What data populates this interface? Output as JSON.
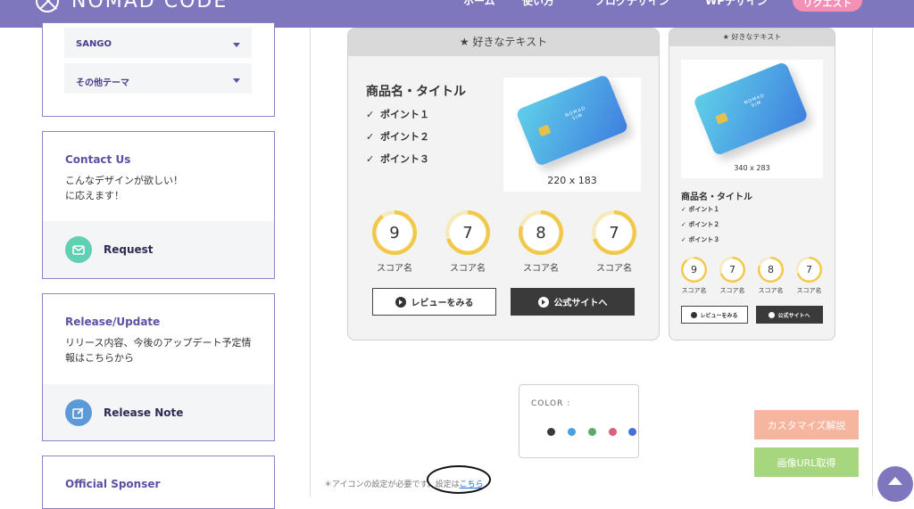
{
  "header": {
    "logo_text": "NOMAD CODE",
    "nav": [
      "ホーム",
      "使い方",
      "ブログデザイン",
      "WPデザイン"
    ],
    "request_button": "リクエスト"
  },
  "sidebar": {
    "themes": [
      {
        "label": "SANGO"
      },
      {
        "label": "その他テーマ"
      }
    ],
    "contact": {
      "title": "Contact Us",
      "text_line1": "こんなデザインが欲しい！",
      "text_line2": "に応えます！",
      "button": "Request"
    },
    "release": {
      "title": "Release/Update",
      "text_line1": "リリース内容、今後のアップデート予定情",
      "text_line2": "報はこちらから",
      "button": "Release Note"
    },
    "sponsor": {
      "title": "Official Sponser"
    }
  },
  "big_card": {
    "header": "好きなテキスト",
    "product_title": "商品名・タイトル",
    "points": [
      "ポイント１",
      "ポイント２",
      "ポイント３"
    ],
    "image_caption": "220 x 183",
    "sim_text_1": "NOMAD",
    "sim_text_2": "SIM",
    "scores": [
      {
        "value": "9",
        "label": "スコア名",
        "fraction": 0.9
      },
      {
        "value": "7",
        "label": "スコア名",
        "fraction": 0.7
      },
      {
        "value": "8",
        "label": "スコア名",
        "fraction": 0.8
      },
      {
        "value": "7",
        "label": "スコア名",
        "fraction": 0.7
      }
    ],
    "review_button": "レビューをみる",
    "official_button": "公式サイトへ"
  },
  "small_card": {
    "header": "好きなテキスト",
    "image_caption": "340 x 283",
    "product_title": "商品名・タイトル",
    "points": [
      "ポイント１",
      "ポイント２",
      "ポイント３"
    ],
    "sim_text_1": "NOMAD",
    "sim_text_2": "SIM",
    "scores": [
      {
        "value": "9",
        "label": "スコア名",
        "fraction": 0.9
      },
      {
        "value": "7",
        "label": "スコア名",
        "fraction": 0.7
      },
      {
        "value": "8",
        "label": "スコア名",
        "fraction": 0.8
      },
      {
        "value": "7",
        "label": "スコア名",
        "fraction": 0.7
      }
    ],
    "review_button": "レビューをみる",
    "official_button": "公式サイトへ"
  },
  "color_picker": {
    "label": "COLOR :",
    "colors": [
      "#3a3a3a",
      "#4b9fdd",
      "#5aaa6e",
      "#d9607a",
      "#4a6fd6"
    ]
  },
  "customize_button": "カスタマイズ解説",
  "image_url_button": "画像URL取得",
  "footnote": {
    "text": "＊アイコンの設定が必要です。設定は",
    "link": "こちら"
  },
  "colors": {
    "brand": "#7f77bd",
    "score_ring": "#f1c84a",
    "customize": "#f6b59f",
    "image_url": "#a6d77e"
  }
}
